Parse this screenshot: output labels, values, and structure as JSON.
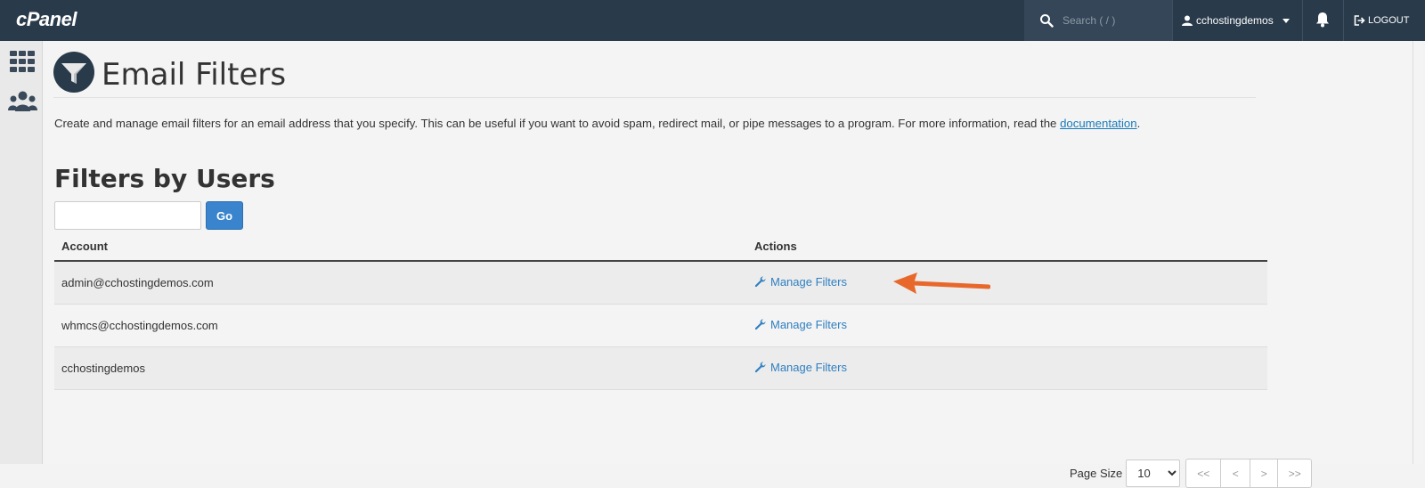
{
  "header": {
    "logo": "cPanel",
    "search_placeholder": "Search ( / )",
    "username": "cchostingdemos",
    "logout_label": "LOGOUT"
  },
  "sidebar": {
    "items": [
      {
        "icon": "apps-grid-icon"
      },
      {
        "icon": "users-icon"
      }
    ]
  },
  "page": {
    "title": "Email Filters",
    "description_prefix": "Create and manage email filters for an email address that you specify. This can be useful if you want to avoid spam, redirect mail, or pipe messages to a program. For more information, read the ",
    "documentation_link": "documentation",
    "description_suffix": ".",
    "section_title": "Filters by Users",
    "go_button": "Go"
  },
  "table": {
    "columns": [
      "Account",
      "Actions"
    ],
    "rows": [
      {
        "account": "admin@cchostingdemos.com",
        "action": "Manage Filters"
      },
      {
        "account": "whmcs@cchostingdemos.com",
        "action": "Manage Filters"
      },
      {
        "account": "cchostingdemos",
        "action": "Manage Filters"
      }
    ]
  },
  "pagination": {
    "page_size_label": "Page Size",
    "page_size": "10",
    "buttons": [
      "<<",
      "<",
      ">",
      ">>"
    ]
  },
  "colors": {
    "topbar": "#293a4a",
    "accent": "#3984cc",
    "link": "#2f7fc1",
    "arrow": "#e8682c"
  }
}
